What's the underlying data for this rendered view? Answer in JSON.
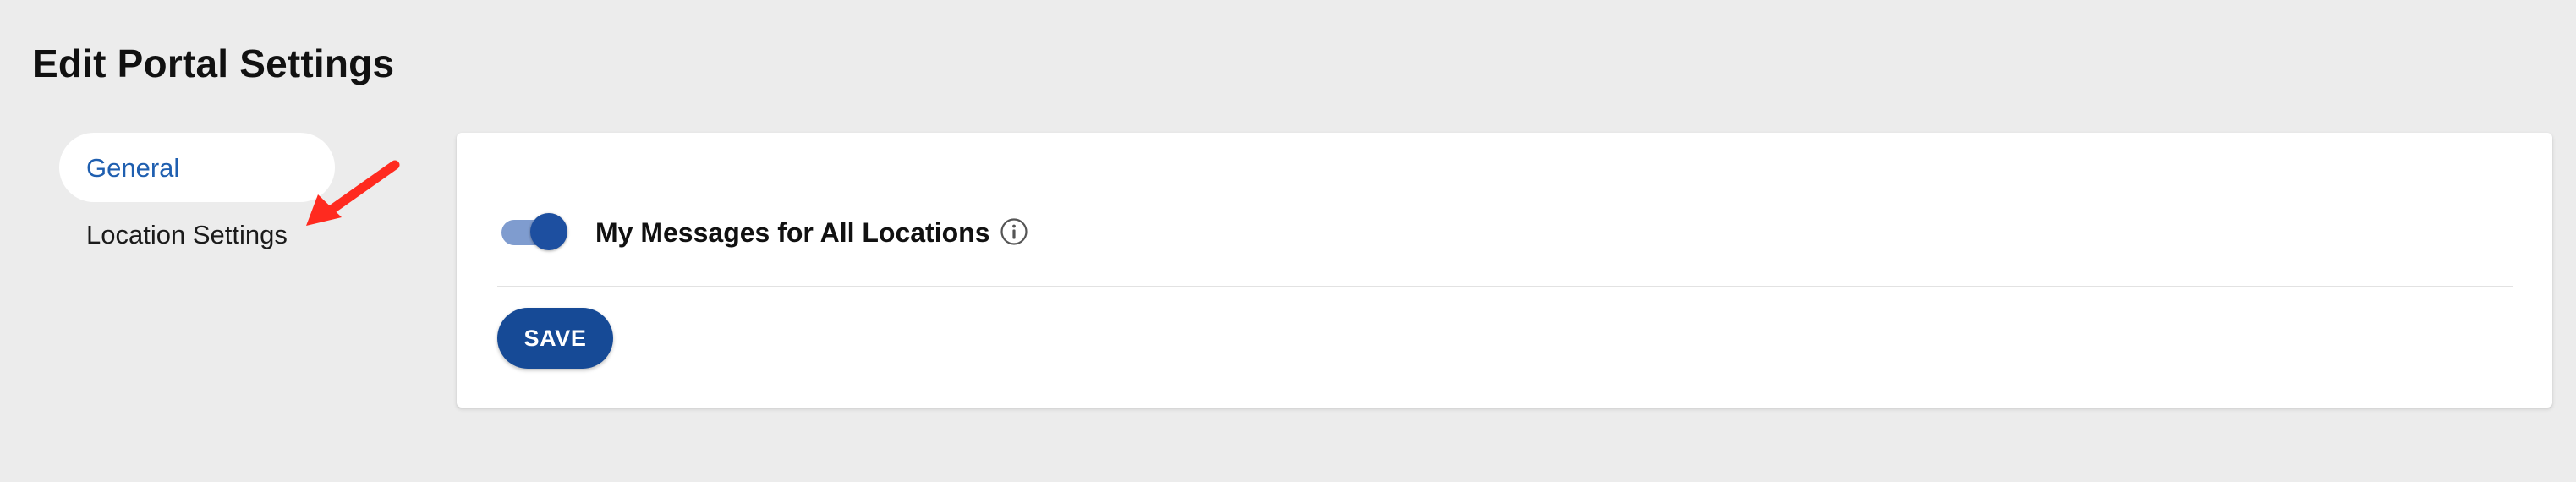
{
  "page": {
    "title": "Edit Portal Settings"
  },
  "sidebar": {
    "items": [
      {
        "label": "General",
        "active": true
      },
      {
        "label": "Location Settings",
        "active": false
      }
    ]
  },
  "settings": {
    "my_messages_toggle": {
      "label": "My Messages for All Locations",
      "enabled": true,
      "info_icon": "info-circle-icon"
    },
    "save_label": "SAVE"
  },
  "annotation": {
    "icon": "red-arrow-icon",
    "color": "#ff2a1f"
  },
  "colors": {
    "accent": "#1f5fb0",
    "button": "#164a96",
    "toggle_thumb": "#1d4fa0",
    "toggle_track": "#7f9ccf",
    "background": "#ececec"
  }
}
